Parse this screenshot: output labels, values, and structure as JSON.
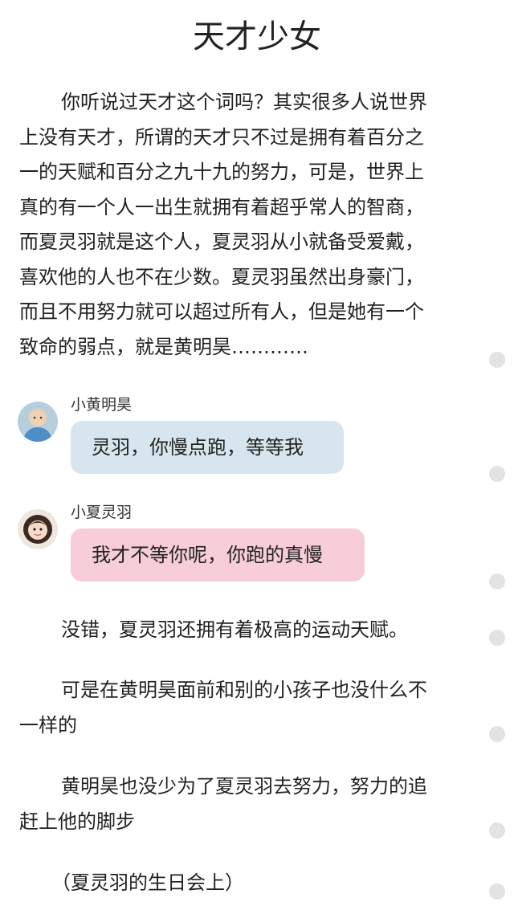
{
  "article": {
    "title": "天才少女",
    "intro_lines": [
      "你听说过天才这个词吗？其实很多人说世界",
      "上没有天才，所谓的天才只不过是拥有着百分之",
      "一的天赋和百分之九十九的努力，可是，世界上",
      "真的有一个人一出生就拥有着超乎常人的智商，",
      "而夏灵羽就是这个人，夏灵羽从小就备受爱戴，",
      "喜欢他的人也不在少数。夏灵羽虽然出身豪门，",
      "而且不用努力就可以超过所有人，但是她有一个",
      "致命的弱点，就是黄明昊…………"
    ],
    "messages": [
      {
        "sender": "小黄明昊",
        "text": "灵羽，你慢点跑，等等我",
        "avatar_icon": "boy-avatar",
        "bubble_color": "#d7e6ee"
      },
      {
        "sender": "小夏灵羽",
        "text": "我才不等你呢，你跑的真慢",
        "avatar_icon": "girl-avatar",
        "bubble_color": "#f6cdd8"
      }
    ],
    "para1": "没错，夏灵羽还拥有着极高的运动天赋。",
    "para2_lines": [
      "可是在黄明昊面前和别的小孩子也没什么不",
      "一样的"
    ],
    "para3_lines": [
      "黄明昊也没少为了夏灵羽去努力，努力的追",
      "赶上他的脚步"
    ],
    "para4": "（夏灵羽的生日会上）"
  }
}
